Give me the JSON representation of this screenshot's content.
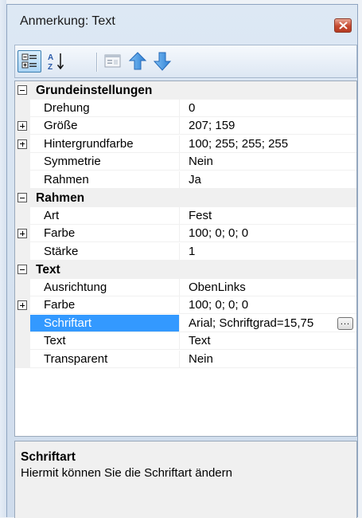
{
  "window": {
    "title": "Anmerkung: Text"
  },
  "toolbar": {
    "buttons": [
      {
        "icon": "categorized-icon",
        "pressed": true
      },
      {
        "icon": "sort-alphabetical-icon",
        "pressed": false
      },
      {
        "icon": "property-pages-icon",
        "pressed": false
      },
      {
        "icon": "arrow-up-icon",
        "pressed": false
      },
      {
        "icon": "arrow-down-icon",
        "pressed": false
      }
    ]
  },
  "grid": {
    "categories": [
      {
        "label": "Grundeinstellungen",
        "expanded": true,
        "rows": [
          {
            "name": "Drehung",
            "value": "0",
            "expandable": false
          },
          {
            "name": "Größe",
            "value": "207; 159",
            "expandable": true
          },
          {
            "name": "Hintergrundfarbe",
            "value": "100; 255; 255; 255",
            "expandable": true
          },
          {
            "name": "Symmetrie",
            "value": "Nein",
            "expandable": false
          },
          {
            "name": "Rahmen",
            "value": "Ja",
            "expandable": false
          }
        ]
      },
      {
        "label": "Rahmen",
        "expanded": true,
        "rows": [
          {
            "name": "Art",
            "value": "Fest",
            "expandable": false
          },
          {
            "name": "Farbe",
            "value": "100; 0; 0; 0",
            "expandable": true
          },
          {
            "name": "Stärke",
            "value": "1",
            "expandable": false
          }
        ]
      },
      {
        "label": "Text",
        "expanded": true,
        "rows": [
          {
            "name": "Ausrichtung",
            "value": "ObenLinks",
            "expandable": false
          },
          {
            "name": "Farbe",
            "value": "100; 0; 0; 0",
            "expandable": true
          },
          {
            "name": "Schriftart",
            "value": "Arial; Schriftgrad=15,75",
            "expandable": false,
            "selected": true,
            "ellipsis": "..."
          },
          {
            "name": "Text",
            "value": "Text",
            "expandable": false
          },
          {
            "name": "Transparent",
            "value": "Nein",
            "expandable": false
          }
        ]
      }
    ]
  },
  "description": {
    "title": "Schriftart",
    "text": "Hiermit können Sie die Schriftart ändern"
  },
  "colors": {
    "selection": "#3399ff",
    "close_button": "#c6492f",
    "arrow": "#3d8fdc"
  }
}
